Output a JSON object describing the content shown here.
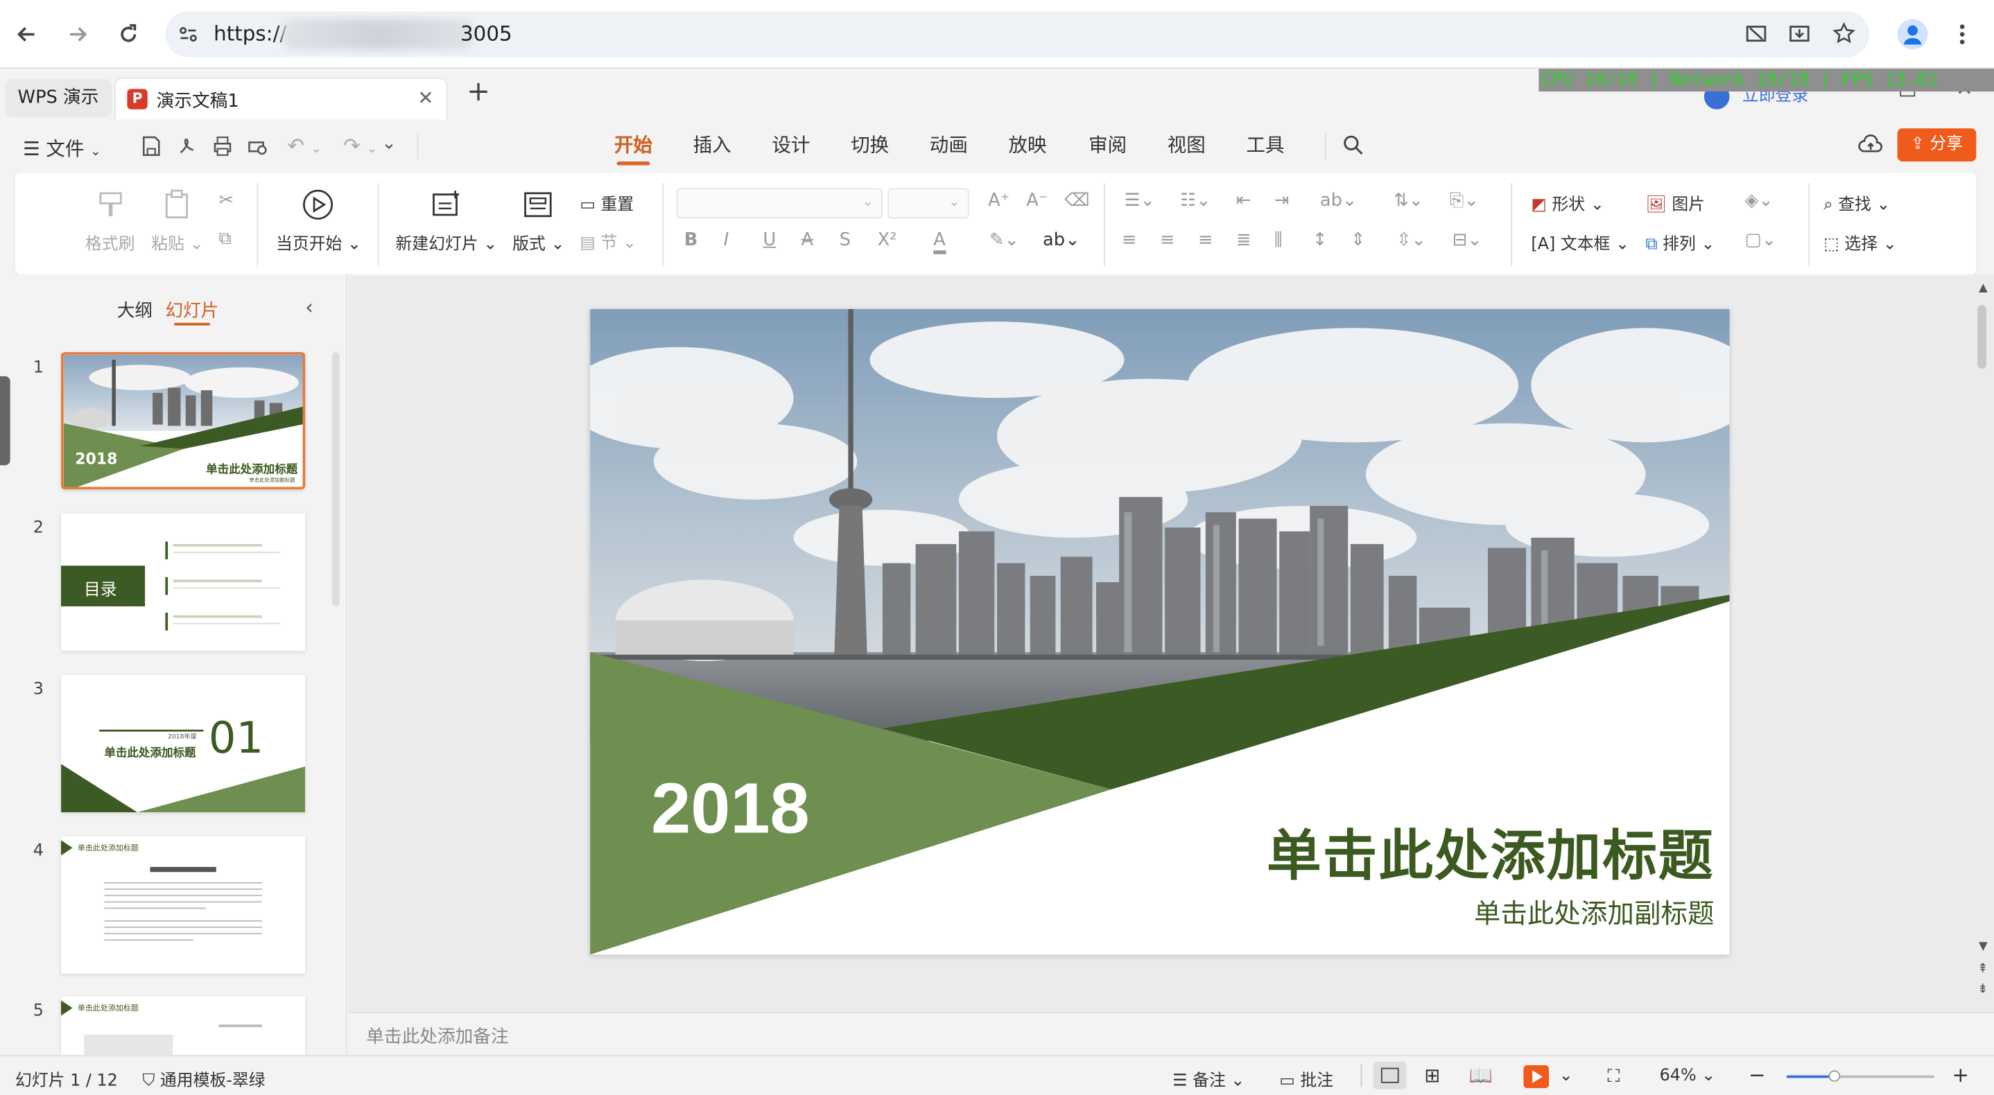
{
  "browser": {
    "url_prefix": "https://",
    "url_suffix": "3005",
    "icons": [
      "back-icon",
      "forward-icon",
      "reload-icon",
      "site-info-icon",
      "screen-icon",
      "install-icon",
      "star-icon",
      "profile-icon",
      "menu-icon"
    ]
  },
  "tabs": {
    "wps_label": "WPS 演示",
    "doc_label": "演示文稿1",
    "doc_icon": "P"
  },
  "perf_overlay": "CPU  10/10 | Network  10/10 | FPS  13.81",
  "account": {
    "login_label": "立即登录"
  },
  "menu": {
    "file_label": "文件",
    "tabs": [
      "开始",
      "插入",
      "设计",
      "切换",
      "动画",
      "放映",
      "审阅",
      "视图",
      "工具"
    ],
    "active_tab": "开始",
    "share_label": "分享"
  },
  "ribbon": {
    "format_painter": "格式刷",
    "paste": "粘贴",
    "from_current": "当页开始",
    "new_slide": "新建幻灯片",
    "layout": "版式",
    "reset": "重置",
    "section": "节",
    "shape": "形状",
    "picture": "图片",
    "textbox": "文本框",
    "arrange": "排列",
    "find": "查找",
    "select": "选择",
    "font_icons": [
      "B",
      "I",
      "U",
      "A",
      "S",
      "X²",
      "A"
    ]
  },
  "panel": {
    "tab_outline": "大纲",
    "tab_slides": "幻灯片",
    "thumbs": [
      {
        "num": "1",
        "year": "2018",
        "title": "单击此处添加标题",
        "subtitle": "单击此处添加副标题"
      },
      {
        "num": "2",
        "label": "目录"
      },
      {
        "num": "3",
        "title": "单击此处添加标题",
        "number": "01",
        "small": "2018年度"
      },
      {
        "num": "4",
        "title": "单击此处添加标题"
      },
      {
        "num": "5",
        "title": "单击此处添加标题"
      }
    ]
  },
  "slide": {
    "year": "2018",
    "title": "单击此处添加标题",
    "subtitle": "单击此处添加副标题",
    "colors": {
      "green_light": "#6e8f4f",
      "green_dark": "#3c5a23",
      "title": "#3b5a1f"
    }
  },
  "notes_placeholder": "单击此处添加备注",
  "status": {
    "slide_counter": "幻灯片 1 / 12",
    "template": "通用模板-翠绿",
    "notes": "备注",
    "comment": "批注",
    "zoom": "64%"
  }
}
